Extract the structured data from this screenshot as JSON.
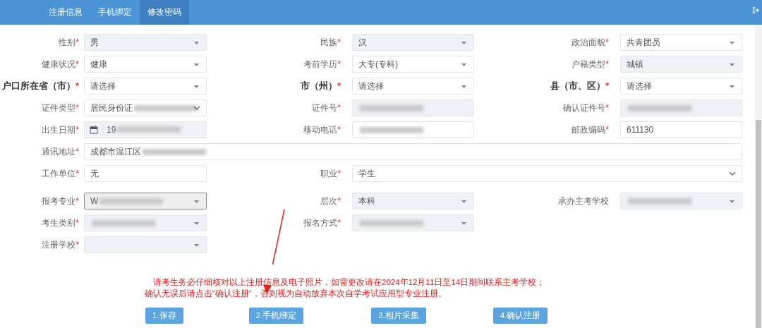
{
  "nav": {
    "tabs": [
      {
        "label": "注册信息",
        "selected": false
      },
      {
        "label": "手机绑定",
        "selected": false
      },
      {
        "label": "修改密码",
        "selected": true
      }
    ]
  },
  "form": {
    "groups": [
      [
        [
          {
            "label": "性别",
            "mark": "*",
            "value": "男",
            "kind": "select",
            "disabled": true
          },
          {
            "label": "民族",
            "mark": "*",
            "value": "汉",
            "kind": "select",
            "disabled": true
          },
          {
            "label": "政治面貌",
            "mark": "*",
            "value": "共青团员",
            "kind": "select",
            "disabled": false
          }
        ],
        [
          {
            "label": "健康状况",
            "mark": "*",
            "value": "健康",
            "kind": "select",
            "disabled": false
          },
          {
            "label": "考前学历",
            "mark": "*",
            "value": "大专(专科)",
            "kind": "select",
            "disabled": false
          },
          {
            "label": "户籍类型",
            "mark": "*",
            "value": "城镇",
            "kind": "select",
            "disabled": true
          }
        ],
        [
          {
            "label": "户口所在省（市）",
            "mark": "*",
            "value": "请选择",
            "kind": "select",
            "disabled": false,
            "emphasis": true
          },
          {
            "label": "市（州）",
            "mark": "*",
            "value": "请选择",
            "kind": "select",
            "disabled": false,
            "emphasis": true
          },
          {
            "label": "县（市、区）",
            "mark": "*",
            "value": "请选择",
            "kind": "select",
            "disabled": false,
            "emphasis": true
          }
        ],
        [
          {
            "label": "证件类型",
            "mark": "*",
            "value": "居民身份证",
            "kind": "chevron",
            "disabled": false,
            "redacted": true
          },
          {
            "label": "证件号",
            "mark": "*",
            "kind": "text",
            "disabled": true,
            "redacted": true
          },
          {
            "label": "确认证件号",
            "mark": "*",
            "kind": "text",
            "disabled": true,
            "redacted": true
          }
        ],
        [
          {
            "label": "出生日期",
            "mark": "*",
            "value": "19",
            "kind": "date",
            "disabled": true,
            "redacted": true
          },
          {
            "label": "移动电话",
            "mark": "*",
            "kind": "text",
            "disabled": false,
            "redacted": true
          },
          {
            "label": "邮政编码",
            "mark": "*",
            "value": "611130",
            "kind": "text",
            "disabled": false
          }
        ],
        [
          {
            "label": "通讯地址",
            "mark": "*",
            "value": "成都市温江区",
            "kind": "text",
            "disabled": false,
            "redacted": true,
            "wide": true
          }
        ],
        [
          {
            "label": "工作单位",
            "mark": "*",
            "value": "无",
            "kind": "text",
            "disabled": false
          },
          {
            "label": "职业",
            "mark": "*",
            "value": "学生",
            "kind": "chevron",
            "disabled": false,
            "wide": true
          }
        ]
      ],
      [
        [
          {
            "label": "报考专业",
            "mark": "*",
            "value": "W",
            "kind": "select",
            "disabled": true,
            "focused": true,
            "redacted": true
          },
          {
            "label": "层次",
            "mark": "*",
            "value": "本科",
            "kind": "select",
            "disabled": true
          },
          {
            "label": "承办主考学校",
            "kind": "select",
            "disabled": true,
            "redacted": true
          }
        ],
        [
          {
            "label": "考生类别",
            "mark": "*",
            "kind": "select",
            "disabled": true,
            "redacted": true
          },
          {
            "label": "报名方式",
            "mark": "*",
            "kind": "select",
            "disabled": true,
            "redacted": true
          }
        ],
        [
          {
            "label": "注册学校",
            "mark": "*",
            "kind": "select",
            "disabled": true
          }
        ]
      ]
    ]
  },
  "notice": [
    "请考生务必仔细核对以上注册信息及电子照片，如需更改请在2024年12月11日至14日期间联系主考学校；",
    "确认无误后请点击“确认注册”，否则视为自动放弃本次自学考试应用型专业注册。"
  ],
  "buttons": [
    "1.保存",
    "2.手机绑定",
    "3.相片采集",
    "4.确认注册"
  ]
}
